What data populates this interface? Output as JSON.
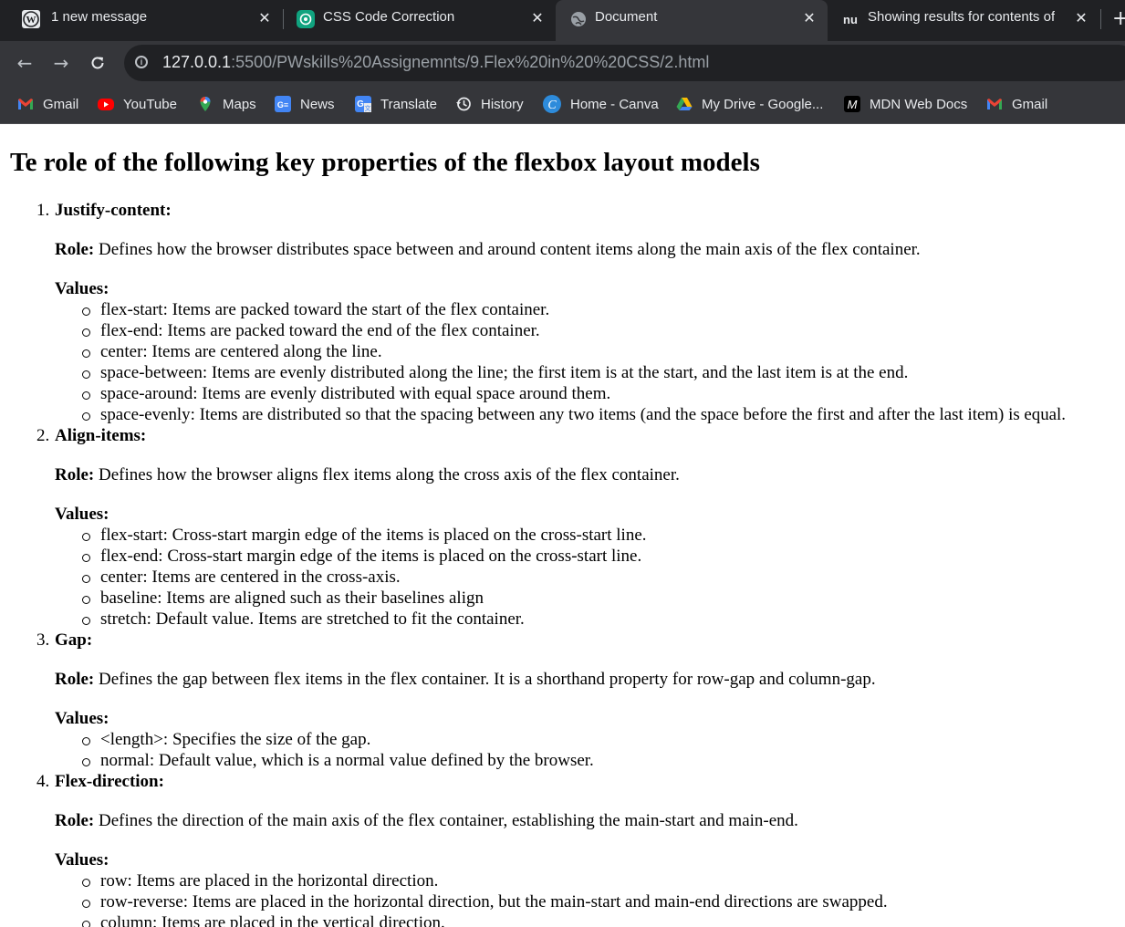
{
  "tabs": [
    {
      "title": "1 new message",
      "icon": "wordpress-icon"
    },
    {
      "title": "CSS Code Correction",
      "icon": "chatgpt-icon"
    },
    {
      "title": "Document",
      "icon": "globe-icon"
    },
    {
      "title": "Showing results for contents of t",
      "icon": "nu-icon"
    }
  ],
  "active_tab_index": 2,
  "address_bar": {
    "host": "127.0.0.1",
    "path": ":5500/PWskills%20Assignemnts/9.Flex%20in%20%20CSS/2.html"
  },
  "bookmarks": [
    {
      "label": "Gmail",
      "icon": "gmail-icon"
    },
    {
      "label": "YouTube",
      "icon": "youtube-icon"
    },
    {
      "label": "Maps",
      "icon": "maps-icon"
    },
    {
      "label": "News",
      "icon": "news-icon"
    },
    {
      "label": "Translate",
      "icon": "translate-icon"
    },
    {
      "label": "History",
      "icon": "history-icon"
    },
    {
      "label": "Home - Canva",
      "icon": "canva-icon"
    },
    {
      "label": "My Drive - Google...",
      "icon": "drive-icon"
    },
    {
      "label": "MDN Web Docs",
      "icon": "mdn-icon"
    },
    {
      "label": "Gmail",
      "icon": "gmail-icon"
    }
  ],
  "page": {
    "heading": "Te role of the following key properties of the flexbox layout models",
    "role_label": "Role:",
    "values_label": "Values:",
    "properties": [
      {
        "num": "1.",
        "name": "Justify-content:",
        "role": "Defines how the browser distributes space between and around content items along the main axis of the flex container.",
        "values": [
          "flex-start: Items are packed toward the start of the flex container.",
          "flex-end: Items are packed toward the end of the flex container.",
          "center: Items are centered along the line.",
          "space-between: Items are evenly distributed along the line; the first item is at the start, and the last item is at the end.",
          "space-around: Items are evenly distributed with equal space around them.",
          "space-evenly: Items are distributed so that the spacing between any two items (and the space before the first and after the last item) is equal."
        ]
      },
      {
        "num": "2.",
        "name": "Align-items:",
        "role": "Defines how the browser aligns flex items along the cross axis of the flex container.",
        "values": [
          "flex-start: Cross-start margin edge of the items is placed on the cross-start line.",
          "flex-end: Cross-start margin edge of the items is placed on the cross-start line.",
          "center: Items are centered in the cross-axis.",
          "baseline: Items are aligned such as their baselines align",
          "stretch: Default value. Items are stretched to fit the container."
        ]
      },
      {
        "num": "3.",
        "name": "Gap:",
        "role": "Defines the gap between flex items in the flex container. It is a shorthand property for row-gap and column-gap.",
        "values": [
          "<length>: Specifies the size of the gap.",
          "normal: Default value, which is a normal value defined by the browser."
        ]
      },
      {
        "num": "4.",
        "name": "Flex-direction:",
        "role": "Defines the direction of the main axis of the flex container, establishing the main-start and main-end.",
        "values": [
          "row: Items are placed in the horizontal direction.",
          "row-reverse: Items are placed in the horizontal direction, but the main-start and main-end directions are swapped.",
          "column: Items are placed in the vertical direction."
        ]
      }
    ]
  }
}
